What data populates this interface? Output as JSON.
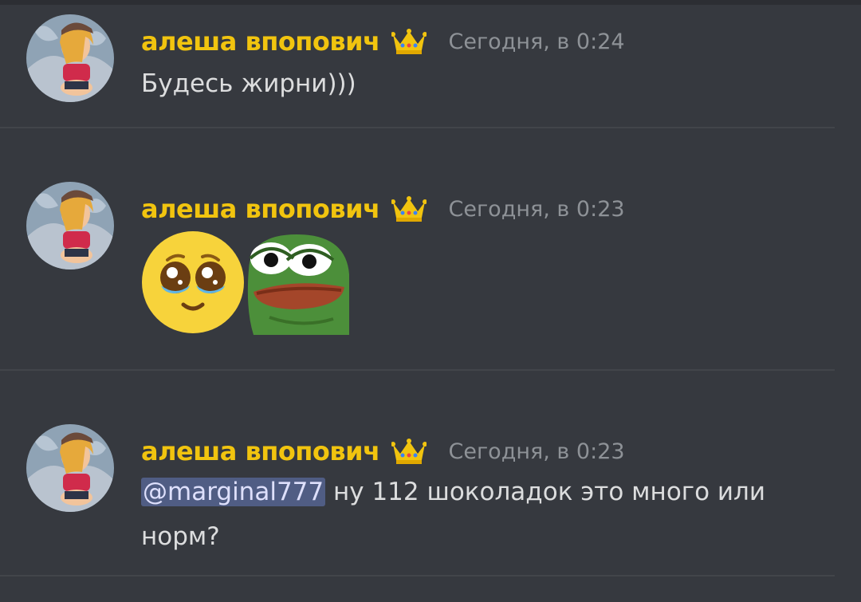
{
  "colors": {
    "background": "#36393f",
    "username": "#f1c40f",
    "timestamp": "#8e9297",
    "text": "#dcddde",
    "mention_bg": "#5865a8",
    "divider": "#42454a"
  },
  "messages": [
    {
      "author": "алеша впопович",
      "badge_icon": "crown-icon",
      "timestamp": "Сегодня, в 0:24",
      "text": "Будесь жирни)))"
    },
    {
      "author": "алеша впопович",
      "badge_icon": "crown-icon",
      "timestamp": "Сегодня, в 0:23",
      "emojis": [
        "pleading-face-emoji",
        "pepe-frog-emoji"
      ]
    },
    {
      "author": "алеша впопович",
      "badge_icon": "crown-icon",
      "timestamp": "Сегодня, в 0:23",
      "mention": "@marginal777",
      "text_line1": " ну 112 шоколадок это много или",
      "text_line2": "норм?"
    }
  ]
}
